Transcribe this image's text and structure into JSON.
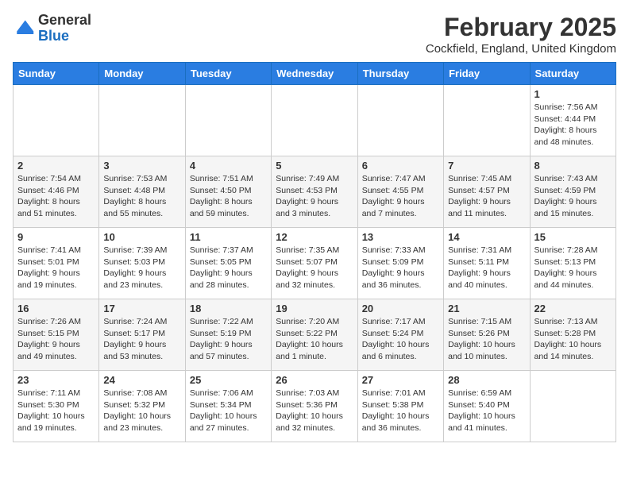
{
  "logo": {
    "general": "General",
    "blue": "Blue"
  },
  "header": {
    "title": "February 2025",
    "subtitle": "Cockfield, England, United Kingdom"
  },
  "weekdays": [
    "Sunday",
    "Monday",
    "Tuesday",
    "Wednesday",
    "Thursday",
    "Friday",
    "Saturday"
  ],
  "weeks": [
    [
      {
        "day": "",
        "detail": ""
      },
      {
        "day": "",
        "detail": ""
      },
      {
        "day": "",
        "detail": ""
      },
      {
        "day": "",
        "detail": ""
      },
      {
        "day": "",
        "detail": ""
      },
      {
        "day": "",
        "detail": ""
      },
      {
        "day": "1",
        "detail": "Sunrise: 7:56 AM\nSunset: 4:44 PM\nDaylight: 8 hours and 48 minutes."
      }
    ],
    [
      {
        "day": "2",
        "detail": "Sunrise: 7:54 AM\nSunset: 4:46 PM\nDaylight: 8 hours and 51 minutes."
      },
      {
        "day": "3",
        "detail": "Sunrise: 7:53 AM\nSunset: 4:48 PM\nDaylight: 8 hours and 55 minutes."
      },
      {
        "day": "4",
        "detail": "Sunrise: 7:51 AM\nSunset: 4:50 PM\nDaylight: 8 hours and 59 minutes."
      },
      {
        "day": "5",
        "detail": "Sunrise: 7:49 AM\nSunset: 4:53 PM\nDaylight: 9 hours and 3 minutes."
      },
      {
        "day": "6",
        "detail": "Sunrise: 7:47 AM\nSunset: 4:55 PM\nDaylight: 9 hours and 7 minutes."
      },
      {
        "day": "7",
        "detail": "Sunrise: 7:45 AM\nSunset: 4:57 PM\nDaylight: 9 hours and 11 minutes."
      },
      {
        "day": "8",
        "detail": "Sunrise: 7:43 AM\nSunset: 4:59 PM\nDaylight: 9 hours and 15 minutes."
      }
    ],
    [
      {
        "day": "9",
        "detail": "Sunrise: 7:41 AM\nSunset: 5:01 PM\nDaylight: 9 hours and 19 minutes."
      },
      {
        "day": "10",
        "detail": "Sunrise: 7:39 AM\nSunset: 5:03 PM\nDaylight: 9 hours and 23 minutes."
      },
      {
        "day": "11",
        "detail": "Sunrise: 7:37 AM\nSunset: 5:05 PM\nDaylight: 9 hours and 28 minutes."
      },
      {
        "day": "12",
        "detail": "Sunrise: 7:35 AM\nSunset: 5:07 PM\nDaylight: 9 hours and 32 minutes."
      },
      {
        "day": "13",
        "detail": "Sunrise: 7:33 AM\nSunset: 5:09 PM\nDaylight: 9 hours and 36 minutes."
      },
      {
        "day": "14",
        "detail": "Sunrise: 7:31 AM\nSunset: 5:11 PM\nDaylight: 9 hours and 40 minutes."
      },
      {
        "day": "15",
        "detail": "Sunrise: 7:28 AM\nSunset: 5:13 PM\nDaylight: 9 hours and 44 minutes."
      }
    ],
    [
      {
        "day": "16",
        "detail": "Sunrise: 7:26 AM\nSunset: 5:15 PM\nDaylight: 9 hours and 49 minutes."
      },
      {
        "day": "17",
        "detail": "Sunrise: 7:24 AM\nSunset: 5:17 PM\nDaylight: 9 hours and 53 minutes."
      },
      {
        "day": "18",
        "detail": "Sunrise: 7:22 AM\nSunset: 5:19 PM\nDaylight: 9 hours and 57 minutes."
      },
      {
        "day": "19",
        "detail": "Sunrise: 7:20 AM\nSunset: 5:22 PM\nDaylight: 10 hours and 1 minute."
      },
      {
        "day": "20",
        "detail": "Sunrise: 7:17 AM\nSunset: 5:24 PM\nDaylight: 10 hours and 6 minutes."
      },
      {
        "day": "21",
        "detail": "Sunrise: 7:15 AM\nSunset: 5:26 PM\nDaylight: 10 hours and 10 minutes."
      },
      {
        "day": "22",
        "detail": "Sunrise: 7:13 AM\nSunset: 5:28 PM\nDaylight: 10 hours and 14 minutes."
      }
    ],
    [
      {
        "day": "23",
        "detail": "Sunrise: 7:11 AM\nSunset: 5:30 PM\nDaylight: 10 hours and 19 minutes."
      },
      {
        "day": "24",
        "detail": "Sunrise: 7:08 AM\nSunset: 5:32 PM\nDaylight: 10 hours and 23 minutes."
      },
      {
        "day": "25",
        "detail": "Sunrise: 7:06 AM\nSunset: 5:34 PM\nDaylight: 10 hours and 27 minutes."
      },
      {
        "day": "26",
        "detail": "Sunrise: 7:03 AM\nSunset: 5:36 PM\nDaylight: 10 hours and 32 minutes."
      },
      {
        "day": "27",
        "detail": "Sunrise: 7:01 AM\nSunset: 5:38 PM\nDaylight: 10 hours and 36 minutes."
      },
      {
        "day": "28",
        "detail": "Sunrise: 6:59 AM\nSunset: 5:40 PM\nDaylight: 10 hours and 41 minutes."
      },
      {
        "day": "",
        "detail": ""
      }
    ]
  ]
}
